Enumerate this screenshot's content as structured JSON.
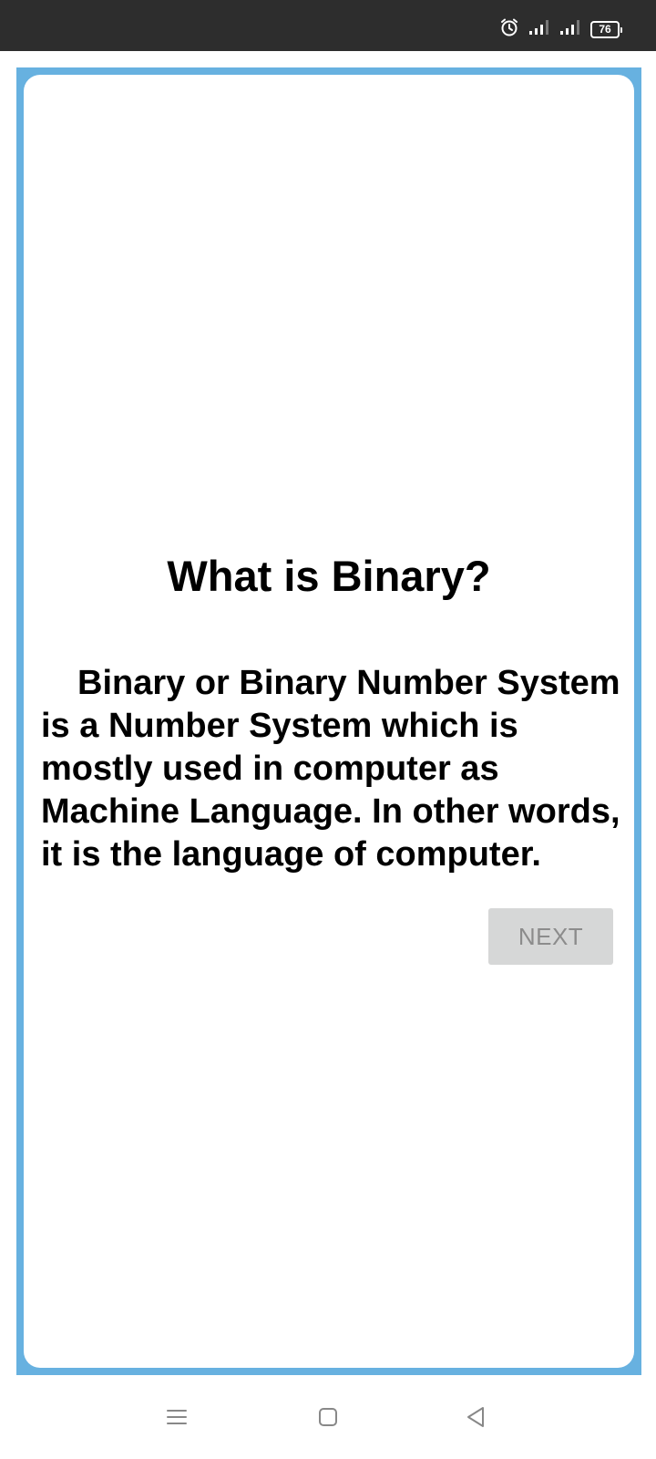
{
  "status_bar": {
    "battery_level": "76",
    "icons": [
      "alarm-icon",
      "signal-icon",
      "signal-icon",
      "battery-icon"
    ]
  },
  "lesson": {
    "title": "What is Binary?",
    "body": "Binary or Binary Number System is a Number System which is mostly used in computer as Machine Language. In other words, it is the language of computer.",
    "next_label": "NEXT"
  },
  "nav_bar": {
    "icons": [
      "menu-icon",
      "home-icon",
      "back-icon"
    ]
  },
  "colors": {
    "frame": "#67b1e0",
    "status_bar": "#2d2d2d",
    "button_bg": "#d6d7d7",
    "button_text": "#8c8c8c"
  }
}
